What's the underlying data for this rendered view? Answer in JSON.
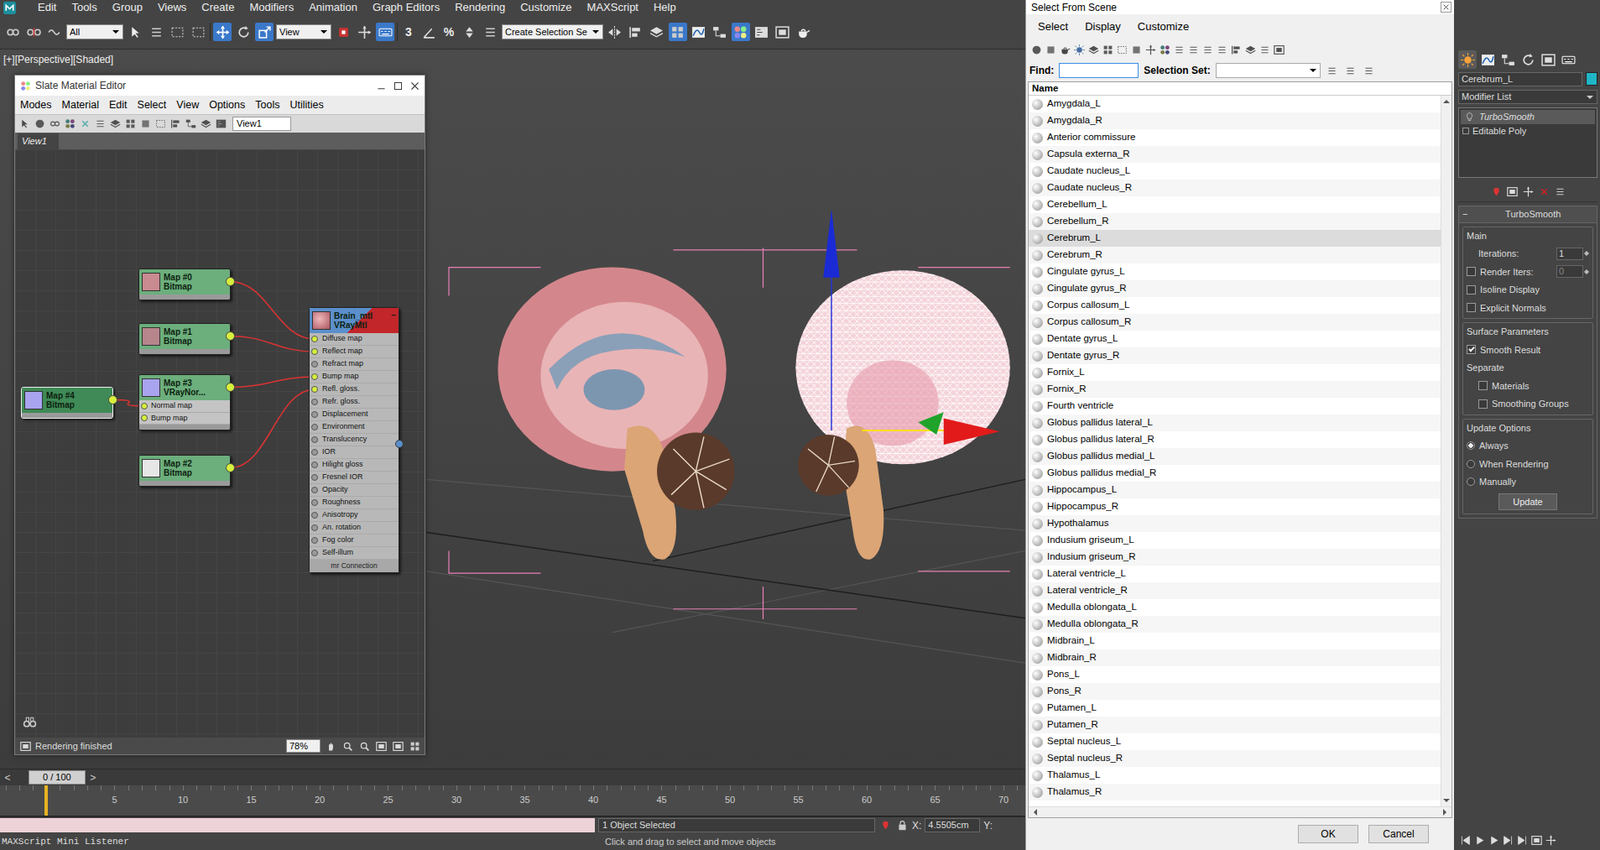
{
  "app": {
    "menu": [
      "Edit",
      "Tools",
      "Group",
      "Views",
      "Create",
      "Modifiers",
      "Animation",
      "Graph Editors",
      "Rendering",
      "Customize",
      "MAXScript",
      "Help"
    ]
  },
  "toolbar": {
    "selection_filter": "All",
    "reference_coord": "View",
    "snap_labels": [
      "3",
      "%"
    ],
    "selection_set": "Create Selection Se"
  },
  "viewport": {
    "label": "[+][Perspective][Shaded]"
  },
  "slate_editor": {
    "title": "Slate Material Editor",
    "menu": [
      "Modes",
      "Material",
      "Edit",
      "Select",
      "View",
      "Options",
      "Tools",
      "Utilities"
    ],
    "view_name": "View1",
    "tab": "View1",
    "status": "Rendering finished",
    "zoom": "78%",
    "nodes": [
      {
        "title": "Map #0",
        "type": "Bitmap",
        "target": "Diffuse map",
        "selected": false,
        "color": "#c98a90",
        "slots": []
      },
      {
        "title": "Map #1",
        "type": "Bitmap",
        "target": "Reflect map",
        "selected": false,
        "color": "#b7858c",
        "slots": []
      },
      {
        "title": "Map #3",
        "type": "VRayNor...",
        "target": "Bump map",
        "selected": false,
        "color": "#a9a4f0",
        "slots": [
          "Normal map",
          "Bump map"
        ]
      },
      {
        "title": "Map #2",
        "type": "Bitmap",
        "target": "Refl. gloss.",
        "selected": false,
        "color": "#e6e6e6",
        "slots": []
      },
      {
        "title": "Map #4",
        "type": "Bitmap",
        "target": "Normal map",
        "selected": true,
        "color": "#a9a4f0",
        "slots": []
      }
    ],
    "material": {
      "name": "Brain_mtl",
      "type": "VRayMtl",
      "collapse": "−",
      "slots": [
        {
          "name": "Diffuse map",
          "connected": true
        },
        {
          "name": "Reflect map",
          "connected": true
        },
        {
          "name": "Refract map",
          "connected": false
        },
        {
          "name": "Bump map",
          "connected": true
        },
        {
          "name": "Refl. gloss.",
          "connected": true
        },
        {
          "name": "Refr. gloss.",
          "connected": false
        },
        {
          "name": "Displacement",
          "connected": false
        },
        {
          "name": "Environment",
          "connected": false
        },
        {
          "name": "Translucency",
          "connected": false
        },
        {
          "name": "IOR",
          "connected": false
        },
        {
          "name": "Hilight gloss",
          "connected": false
        },
        {
          "name": "Fresnel IOR",
          "connected": false
        },
        {
          "name": "Opacity",
          "connected": false
        },
        {
          "name": "Roughness",
          "connected": false
        },
        {
          "name": "Anisotropy",
          "connected": false
        },
        {
          "name": "An. rotation",
          "connected": false
        },
        {
          "name": "Fog color",
          "connected": false
        },
        {
          "name": "Self-illum",
          "connected": false
        }
      ],
      "footer": "mr Connection"
    }
  },
  "timeline": {
    "frame": "0 / 100",
    "prev": "<",
    "next": ">",
    "ticks": [
      "5",
      "10",
      "15",
      "20",
      "25",
      "30",
      "35",
      "40",
      "45",
      "50",
      "55",
      "60",
      "65",
      "70"
    ]
  },
  "status_bar": {
    "selected_count": "1 Object Selected",
    "x_label": "X:",
    "x_value": "4.5505cm",
    "y_label": "Y:",
    "listener": "MAXScript Mini Listener",
    "prompt": "Click and drag to select and move objects"
  },
  "scene_dialog": {
    "title": "Select From Scene",
    "menu": [
      "Select",
      "Display",
      "Customize"
    ],
    "find_label": "Find:",
    "find_value": "",
    "selection_set_label": "Selection Set:",
    "column": "Name",
    "items": [
      {
        "name": "Amygdala_L",
        "selected": false
      },
      {
        "name": "Amygdala_R",
        "selected": false
      },
      {
        "name": "Anterior commissure",
        "selected": false
      },
      {
        "name": "Capsula externa_R",
        "selected": false
      },
      {
        "name": "Caudate nucleus_L",
        "selected": false
      },
      {
        "name": "Caudate nucleus_R",
        "selected": false
      },
      {
        "name": "Cerebellum_L",
        "selected": false
      },
      {
        "name": "Cerebellum_R",
        "selected": false
      },
      {
        "name": "Cerebrum_L",
        "selected": true
      },
      {
        "name": "Cerebrum_R",
        "selected": false
      },
      {
        "name": "Cingulate gyrus_L",
        "selected": false
      },
      {
        "name": "Cingulate gyrus_R",
        "selected": false
      },
      {
        "name": "Corpus callosum_L",
        "selected": false
      },
      {
        "name": "Corpus callosum_R",
        "selected": false
      },
      {
        "name": "Dentate gyrus_L",
        "selected": false
      },
      {
        "name": "Dentate gyrus_R",
        "selected": false
      },
      {
        "name": "Fornix_L",
        "selected": false
      },
      {
        "name": "Fornix_R",
        "selected": false
      },
      {
        "name": "Fourth ventricle",
        "selected": false
      },
      {
        "name": "Globus pallidus lateral_L",
        "selected": false
      },
      {
        "name": "Globus pallidus lateral_R",
        "selected": false
      },
      {
        "name": "Globus pallidus medial_L",
        "selected": false
      },
      {
        "name": "Globus pallidus medial_R",
        "selected": false
      },
      {
        "name": "Hippocampus_L",
        "selected": false
      },
      {
        "name": "Hippocampus_R",
        "selected": false
      },
      {
        "name": "Hypothalamus",
        "selected": false
      },
      {
        "name": "Indusium griseum_L",
        "selected": false
      },
      {
        "name": "Indusium griseum_R",
        "selected": false
      },
      {
        "name": "Lateral ventricle_L",
        "selected": false
      },
      {
        "name": "Lateral ventricle_R",
        "selected": false
      },
      {
        "name": "Medulla oblongata_L",
        "selected": false
      },
      {
        "name": "Medulla oblongata_R",
        "selected": false
      },
      {
        "name": "Midbrain_L",
        "selected": false
      },
      {
        "name": "Midbrain_R",
        "selected": false
      },
      {
        "name": "Pons_L",
        "selected": false
      },
      {
        "name": "Pons_R",
        "selected": false
      },
      {
        "name": "Putamen_L",
        "selected": false
      },
      {
        "name": "Putamen_R",
        "selected": false
      },
      {
        "name": "Septal nucleus_L",
        "selected": false
      },
      {
        "name": "Septal nucleus_R",
        "selected": false
      },
      {
        "name": "Thalamus_L",
        "selected": false
      },
      {
        "name": "Thalamus_R",
        "selected": false
      }
    ],
    "buttons": [
      "OK",
      "Cancel"
    ]
  },
  "command_panel": {
    "object_name": "Cerebrum_L",
    "color": "#1fb5c6",
    "modifier_list": "Modifier List",
    "stack": [
      {
        "name": "TurboSmooth",
        "selected": true,
        "kind": "modifier"
      },
      {
        "name": "Editable Poly",
        "selected": false,
        "kind": "base"
      }
    ],
    "rollout": {
      "title": "TurboSmooth",
      "toggle": "−"
    },
    "main": {
      "title": "Main",
      "iterations_label": "Iterations:",
      "iterations": "1",
      "render_iters_label": "Render Iters:",
      "render_iters": "0",
      "render_iters_checked": false,
      "render_iters_disabled": true,
      "options": [
        {
          "label": "Isoline Display",
          "checked": false
        },
        {
          "label": "Explicit Normals",
          "checked": false
        }
      ]
    },
    "surface": {
      "title": "Surface Parameters",
      "smooth_result": {
        "label": "Smooth Result",
        "checked": true
      },
      "separate_label": "Separate",
      "separate": [
        {
          "label": "Materials",
          "checked": false
        },
        {
          "label": "Smoothing Groups",
          "checked": false
        }
      ]
    },
    "update": {
      "title": "Update Options",
      "modes": [
        {
          "label": "Always",
          "selected": true
        },
        {
          "label": "When Rendering",
          "selected": false
        },
        {
          "label": "Manually",
          "selected": false
        }
      ],
      "button": "Update"
    }
  }
}
